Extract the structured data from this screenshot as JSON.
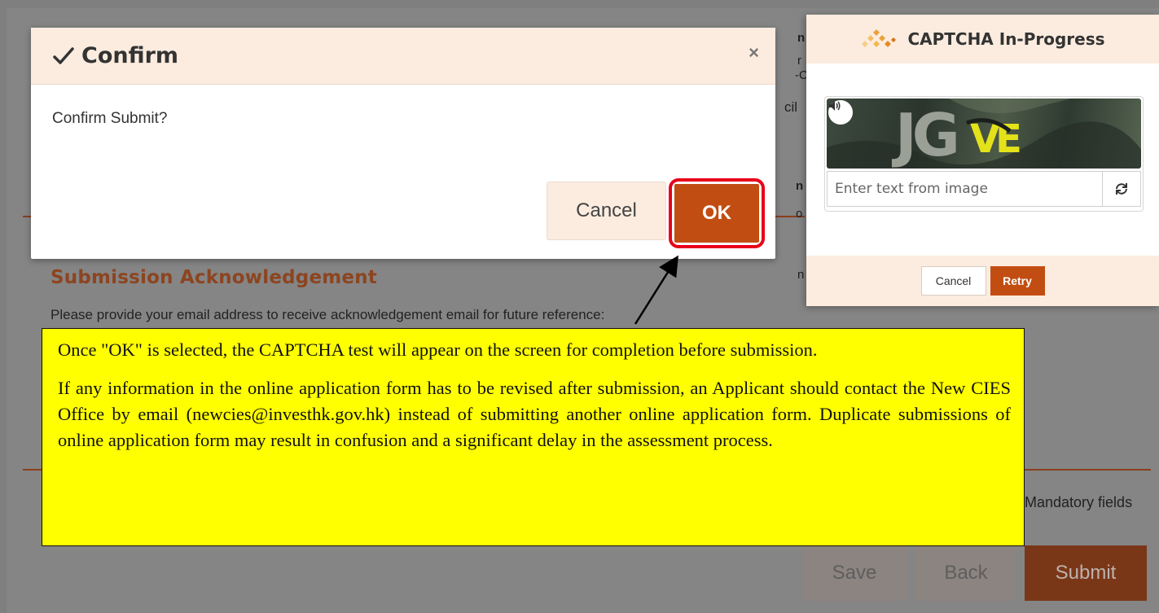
{
  "background": {
    "section_title": "Submission Acknowledgement",
    "section_text": "Please provide your email address to receive acknowledgement email for future reference:",
    "mandatory_note": "Mandatory fields",
    "buttons": {
      "save": "Save",
      "back": "Back",
      "submit": "Submit"
    },
    "fragments": [
      "n",
      "r",
      "-C",
      "cil",
      "n",
      "o",
      "n"
    ]
  },
  "confirm_dialog": {
    "title": "Confirm",
    "message": "Confirm Submit?",
    "cancel_label": "Cancel",
    "ok_label": "OK",
    "close_glyph": "×"
  },
  "captcha": {
    "title": "CAPTCHA In-Progress",
    "image_text": "JGVE",
    "input_placeholder": "Enter text from image",
    "cancel_label": "Cancel",
    "retry_label": "Retry"
  },
  "callout": {
    "paragraph_1": "Once \"OK\" is selected, the CAPTCHA test will appear on the screen for completion before submission.",
    "paragraph_2": "If any information in the online application form has to be revised after submission, an Applicant should contact the New CIES Office by email (newcies@investhk.gov.hk) instead of submitting another online application form.  Duplicate submissions of online application form may result in confusion and a significant delay in the assessment process."
  },
  "colors": {
    "accent": "#c24d12",
    "highlight_border": "#e8001a",
    "callout_bg": "#ffff00",
    "header_bg": "#fcecdf"
  },
  "icons": {
    "confirm": "check-icon",
    "close": "close-icon",
    "captcha_logo": "diamond-cluster-icon",
    "audio": "speaker-icon",
    "refresh": "refresh-icon"
  }
}
